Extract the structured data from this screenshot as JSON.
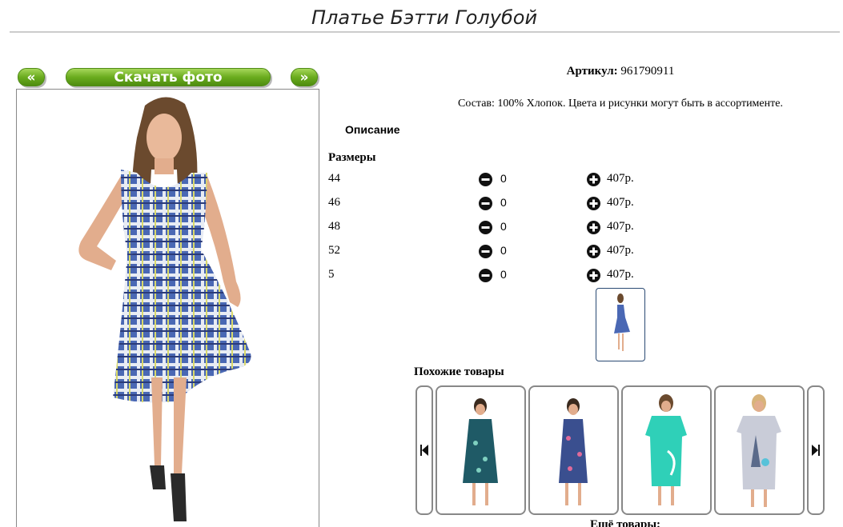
{
  "page": {
    "title": "Платье Бэтти Голубой"
  },
  "gallery": {
    "prev_label": "«",
    "download_label": "Скачать фото",
    "next_label": "»"
  },
  "product": {
    "article_label": "Артикул:",
    "article_value": "961790911",
    "composition": "Состав: 100% Хлопок. Цвета и рисунки могут быть в ассортименте.",
    "description_tab": "Описание",
    "sizes_heading": "Размеры",
    "sizes": [
      {
        "size": "44",
        "qty": "0",
        "price": "407р."
      },
      {
        "size": "46",
        "qty": "0",
        "price": "407р."
      },
      {
        "size": "48",
        "qty": "0",
        "price": "407р."
      },
      {
        "size": "52",
        "qty": "0",
        "price": "407р."
      },
      {
        "size": "5",
        "qty": "0",
        "price": "407р."
      }
    ]
  },
  "similar": {
    "heading": "Похожие товары",
    "items": [
      {
        "name": "dark-teal-floral-dress",
        "color": "#1f5a66"
      },
      {
        "name": "blue-floral-dress",
        "color": "#3a4f8f"
      },
      {
        "name": "turquoise-nightshirt",
        "color": "#2fd0b8"
      },
      {
        "name": "grey-paris-nightshirt",
        "color": "#c9ccd8"
      }
    ],
    "prev_icon": "skip-back-icon",
    "next_icon": "skip-forward-icon"
  },
  "more": {
    "heading": "Ещё товары:"
  },
  "colors": {
    "button_green": "#6aac1e",
    "dress_blue": "#4060a8",
    "rule_grey": "#cccccc"
  }
}
